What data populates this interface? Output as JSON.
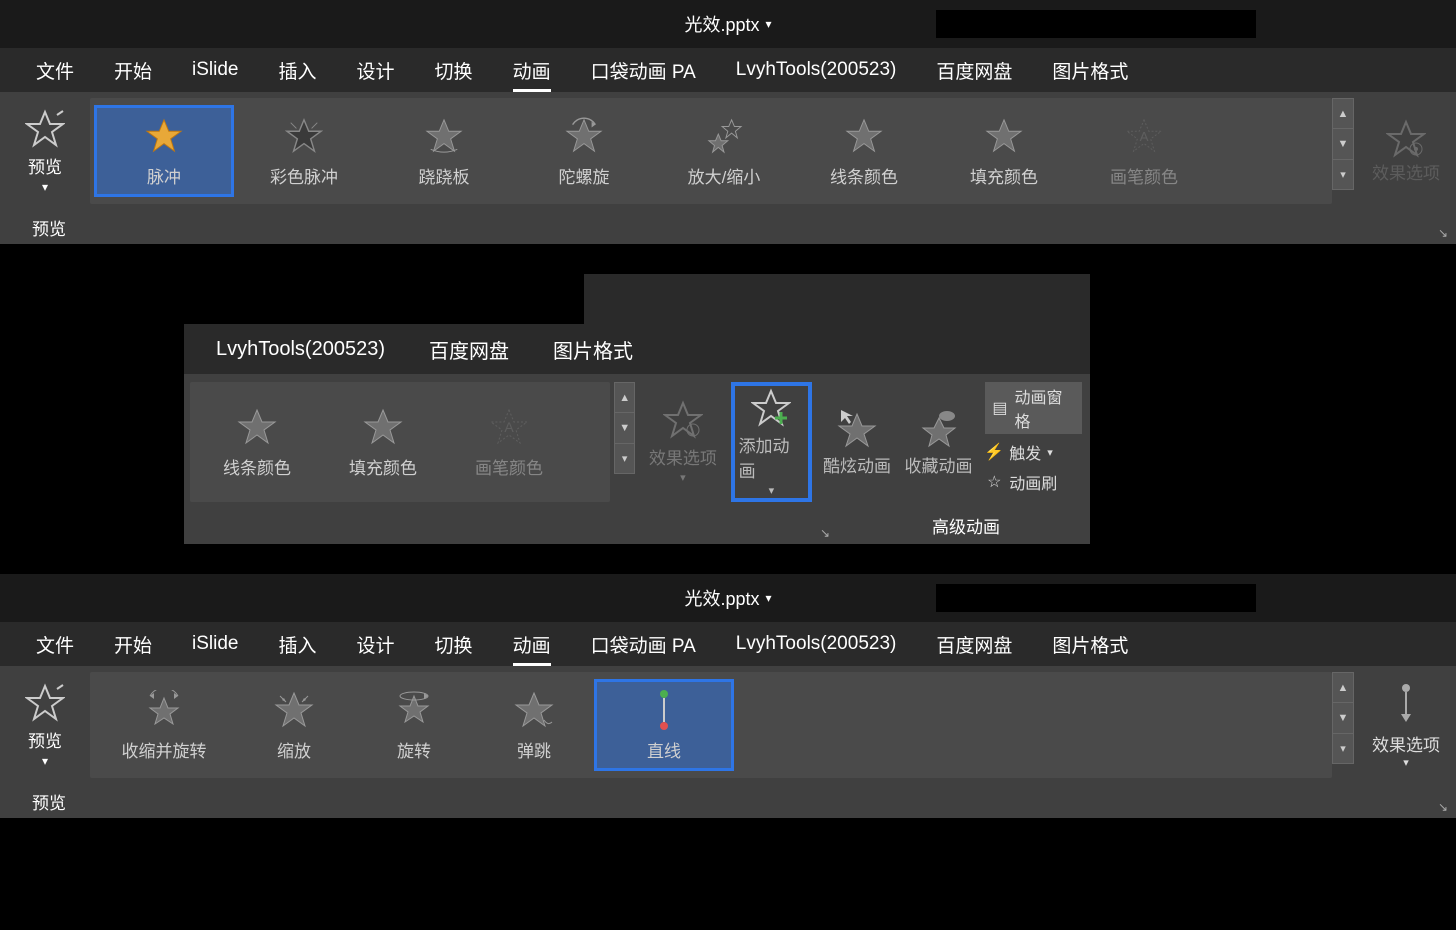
{
  "title": "光效.pptx",
  "tabs": {
    "file": "文件",
    "home": "开始",
    "islide": "iSlide",
    "insert": "插入",
    "design": "设计",
    "transition": "切换",
    "animation": "动画",
    "pocket": "口袋动画 PA",
    "lvyh": "LvyhTools(200523)",
    "baidu": "百度网盘",
    "picformat": "图片格式"
  },
  "preview": {
    "label": "预览",
    "group": "预览"
  },
  "effect_options": "效果选项",
  "gallery1": {
    "pulse": "脉冲",
    "color_pulse": "彩色脉冲",
    "teeter": "跷跷板",
    "spin": "陀螺旋",
    "growshrink": "放大/缩小",
    "linecolor": "线条颜色",
    "fillcolor": "填充颜色",
    "brushcolor": "画笔颜色"
  },
  "section2": {
    "gallery": {
      "linecolor": "线条颜色",
      "fillcolor": "填充颜色",
      "brushcolor": "画笔颜色"
    },
    "effect_options": "效果选项",
    "add_animation": "添加动画",
    "cool_anim": "酷炫动画",
    "fav_anim": "收藏动画",
    "anim_pane": "动画窗格",
    "trigger": "触发",
    "anim_painter": "动画刷",
    "group": "高级动画"
  },
  "gallery3": {
    "shrinkturn": "收缩并旋转",
    "zoom": "缩放",
    "swivel": "旋转",
    "bounce": "弹跳",
    "line": "直线"
  }
}
